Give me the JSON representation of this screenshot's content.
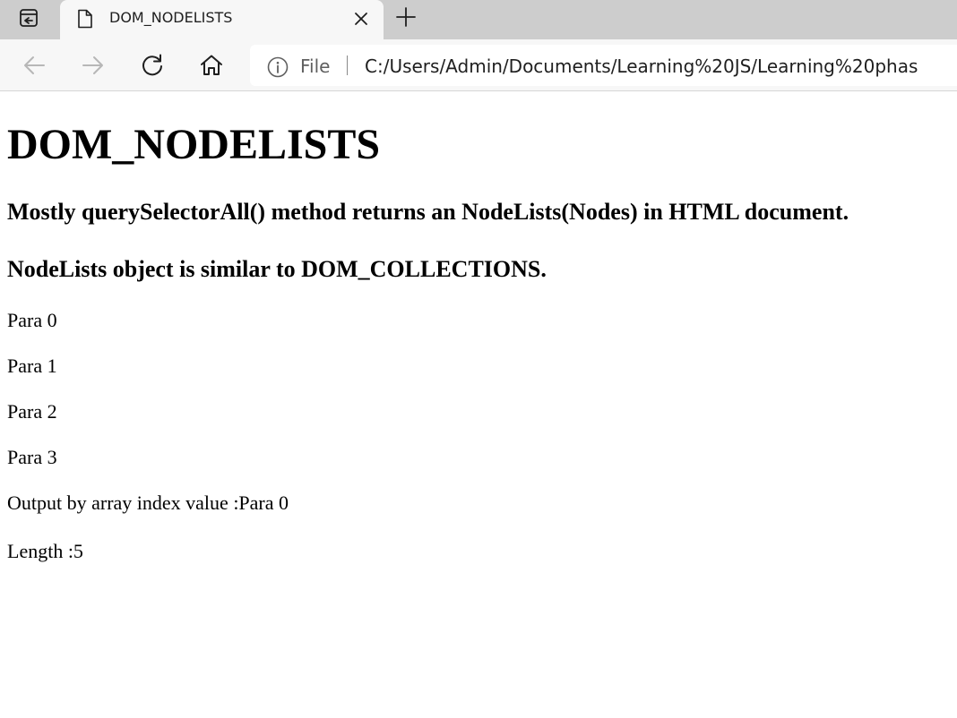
{
  "browser": {
    "tab": {
      "title": "DOM_NODELISTS"
    },
    "address_bar": {
      "scheme_label": "File",
      "url": "C:/Users/Admin/Documents/Learning%20JS/Learning%20phas"
    },
    "icons": {
      "tab_actions": "tab-actions-icon",
      "favicon": "page-icon",
      "close": "close-icon",
      "new_tab": "plus-icon",
      "back": "arrow-left-icon",
      "forward": "arrow-right-icon",
      "refresh": "refresh-icon",
      "home": "home-icon",
      "site_info": "info-icon"
    },
    "colors": {
      "tabstrip": "#cdcdcd",
      "toolbar": "#f7f7f7",
      "disabled_icon": "#b7b7b7"
    }
  },
  "page": {
    "heading": "DOM_NODELISTS",
    "subheading_1": "Mostly querySelectorAll() method returns an NodeLists(Nodes) in HTML document.",
    "subheading_2": "NodeLists object is similar to DOM_COLLECTIONS.",
    "paragraphs": [
      "Para 0",
      "Para 1",
      "Para 2",
      "Para 3"
    ],
    "output_line": "Output by array index value :Para 0",
    "length_line": "Length :5"
  }
}
